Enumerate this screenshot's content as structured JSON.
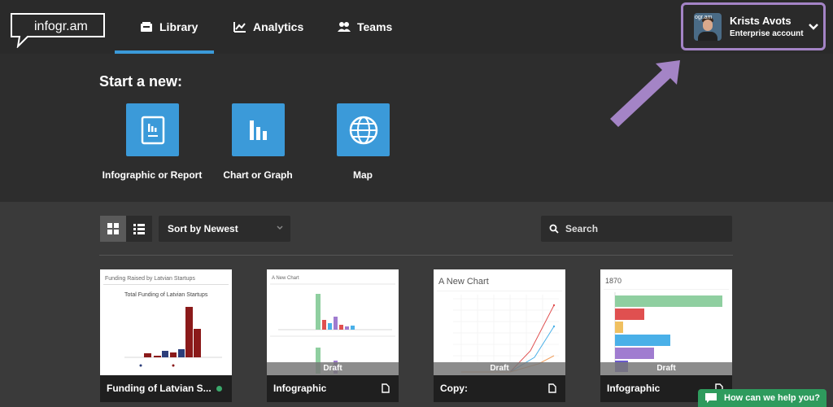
{
  "brand": {
    "logo_text": "infogr.am"
  },
  "nav": {
    "tabs": [
      {
        "label": "Library",
        "icon": "library-icon"
      },
      {
        "label": "Analytics",
        "icon": "analytics-icon"
      },
      {
        "label": "Teams",
        "icon": "teams-icon"
      }
    ],
    "active_tab": "Library"
  },
  "account": {
    "name": "Krists Avots",
    "plan": "Enterprise account",
    "avatar_text": "ogr.am"
  },
  "start": {
    "title": "Start a new:",
    "options": [
      {
        "label": "Infographic or Report",
        "icon": "report-icon"
      },
      {
        "label": "Chart or Graph",
        "icon": "bar-chart-icon"
      },
      {
        "label": "Map",
        "icon": "globe-icon"
      }
    ]
  },
  "toolbar": {
    "sort_label": "Sort by Newest",
    "search_placeholder": "Search"
  },
  "cards": [
    {
      "name": "Funding of Latvian S...",
      "thumb_title": "Funding Raised by Latvian Startups",
      "thumb_subtitle": "Total Funding of Latvian Startups",
      "status": "published"
    },
    {
      "name": "Infographic",
      "thumb_title": "A New Chart",
      "draft": "Draft"
    },
    {
      "name": "Copy:",
      "thumb_title": "A New Chart",
      "draft": "Draft"
    },
    {
      "name": "Infographic",
      "thumb_title": "1870",
      "draft": "Draft"
    }
  ],
  "help": {
    "label": "How can we help you?"
  },
  "colors": {
    "accent": "#3b9ad9",
    "highlight": "#a484c6",
    "help_green": "#2e9b5d"
  }
}
